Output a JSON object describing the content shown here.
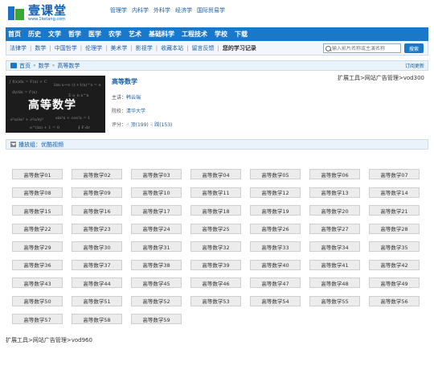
{
  "logo": {
    "title": "壹课堂",
    "url": "www.1ketang.com"
  },
  "top_links": [
    "管理学",
    "内科学",
    "外科学",
    "经济学",
    "国际贸易学"
  ],
  "nav": [
    "首页",
    "历史",
    "文学",
    "哲学",
    "医学",
    "农学",
    "艺术",
    "基础科学",
    "工程技术",
    "学校",
    "下载"
  ],
  "subnav": {
    "items": [
      "法律学",
      "数学",
      "中国哲学",
      "伦理学",
      "美术学",
      "影视学",
      "收藏本站",
      "留言反馈",
      "您的学习记录"
    ],
    "search_placeholder": "输入影片名称或主演名称",
    "search_button": "搜索"
  },
  "breadcrumb": {
    "items": [
      "首页",
      "数学",
      "高等数学"
    ],
    "subscribe": "订阅更新"
  },
  "course": {
    "cover_title": "高等数学",
    "cover_formulas": [
      "∫ f(x)dx = F(x) + C",
      "lim x→∞ (1+1/x)^x = e",
      "dy/dx = f'(x)",
      "Σ a_n x^n",
      "∂²u/∂x² + ∂²u/∂y²",
      "sin²x + cos²x = 1",
      "e^(iπ) + 1 = 0",
      "∮ F·dr"
    ],
    "name": "高等数学",
    "teacher_label": "主讲：",
    "teacher": "韩云瑞",
    "school_label": "院校：",
    "school": "清华大学",
    "rating_label": "评分：",
    "up_label": "顶",
    "up_count": "(199)",
    "down_label": "踩",
    "down_count": "(153)"
  },
  "ad_top": "扩展工具>网站广告管理>vod300",
  "playlist": {
    "title": "播放组：优酷视频"
  },
  "episodes": [
    "高等数学01",
    "高等数学02",
    "高等数学03",
    "高等数学04",
    "高等数学05",
    "高等数学06",
    "高等数学07",
    "高等数学08",
    "高等数学09",
    "高等数学10",
    "高等数学11",
    "高等数学12",
    "高等数学13",
    "高等数学14",
    "高等数学15",
    "高等数学16",
    "高等数学17",
    "高等数学18",
    "高等数学19",
    "高等数学20",
    "高等数学21",
    "高等数学22",
    "高等数学23",
    "高等数学24",
    "高等数学25",
    "高等数学26",
    "高等数学27",
    "高等数学28",
    "高等数学29",
    "高等数学30",
    "高等数学31",
    "高等数学32",
    "高等数学33",
    "高等数学34",
    "高等数学35",
    "高等数学36",
    "高等数学37",
    "高等数学38",
    "高等数学39",
    "高等数学40",
    "高等数学41",
    "高等数学42",
    "高等数学43",
    "高等数学44",
    "高等数学45",
    "高等数学46",
    "高等数学47",
    "高等数学48",
    "高等数学49",
    "高等数学50",
    "高等数学51",
    "高等数学52",
    "高等数学53",
    "高等数学54",
    "高等数学55",
    "高等数学56",
    "高等数学57",
    "高等数学58",
    "高等数学59"
  ],
  "ad_bottom": "扩展工具>网站广告管理>vod960"
}
